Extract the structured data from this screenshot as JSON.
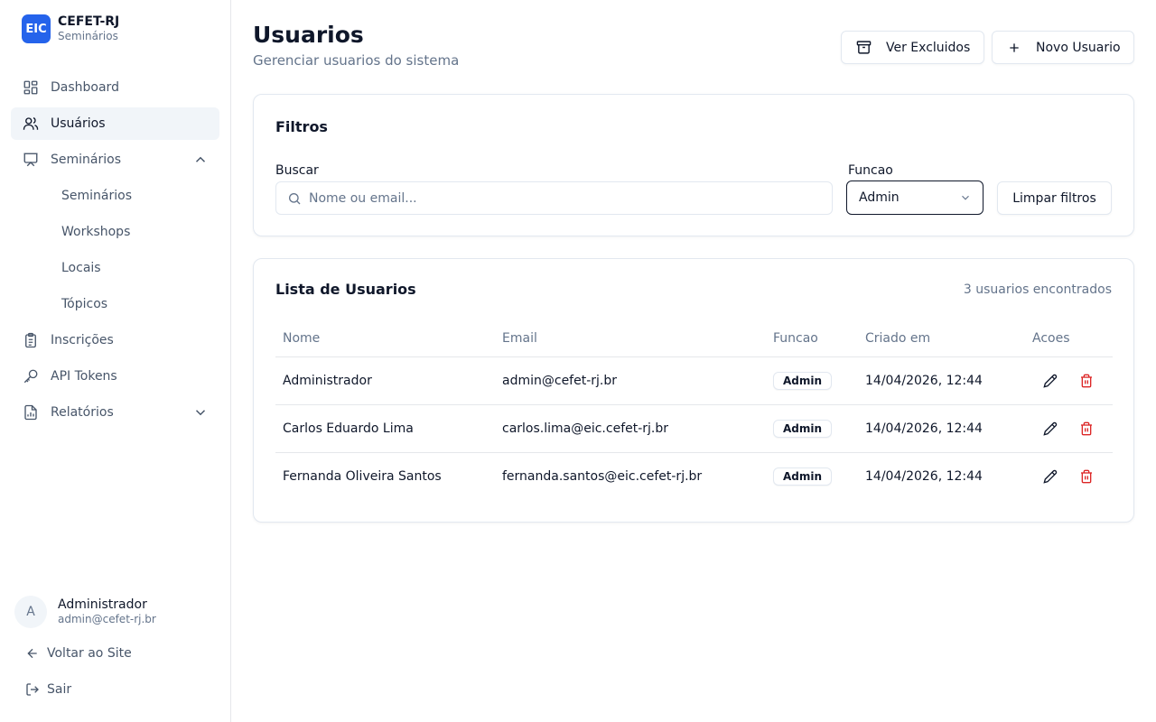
{
  "brand": {
    "logo": "EIC",
    "title": "CEFET-RJ",
    "subtitle": "Seminários",
    "color": "#2563eb"
  },
  "sidebar": {
    "items": [
      {
        "label": "Dashboard",
        "icon": "dashboard-icon"
      },
      {
        "label": "Usuários",
        "icon": "users-icon",
        "active": true
      },
      {
        "label": "Seminários",
        "icon": "presentation-icon",
        "expanded": true
      },
      {
        "label": "Inscrições",
        "icon": "clipboard-icon"
      },
      {
        "label": "API Tokens",
        "icon": "key-icon"
      },
      {
        "label": "Relatórios",
        "icon": "report-icon"
      }
    ],
    "subitems": [
      {
        "label": "Seminários"
      },
      {
        "label": "Workshops"
      },
      {
        "label": "Locais"
      },
      {
        "label": "Tópicos"
      }
    ]
  },
  "user": {
    "initial": "A",
    "name": "Administrador",
    "email": "admin@cefet-rj.br"
  },
  "footer": {
    "back": "Voltar ao Site",
    "logout": "Sair"
  },
  "header": {
    "title": "Usuarios",
    "subtitle": "Gerenciar usuarios do sistema",
    "deleted_button": "Ver Excluidos",
    "new_button": "Novo Usuario"
  },
  "filters": {
    "title": "Filtros",
    "search_label": "Buscar",
    "search_placeholder": "Nome ou email...",
    "search_value": "",
    "role_label": "Funcao",
    "role_value": "Admin",
    "clear_button": "Limpar filtros"
  },
  "list": {
    "title": "Lista de Usuarios",
    "count": "3 usuarios encontrados",
    "columns": [
      "Nome",
      "Email",
      "Funcao",
      "Criado em",
      "Acoes"
    ],
    "rows": [
      {
        "name": "Administrador",
        "email": "admin@cefet-rj.br",
        "role": "Admin",
        "created": "14/04/2026, 12:44"
      },
      {
        "name": "Carlos Eduardo Lima",
        "email": "carlos.lima@eic.cefet-rj.br",
        "role": "Admin",
        "created": "14/04/2026, 12:44"
      },
      {
        "name": "Fernanda Oliveira Santos",
        "email": "fernanda.santos@eic.cefet-rj.br",
        "role": "Admin",
        "created": "14/04/2026, 12:44"
      }
    ]
  },
  "colors": {
    "danger": "#dc2626",
    "muted": "#64748b",
    "border": "#e2e8f0"
  }
}
